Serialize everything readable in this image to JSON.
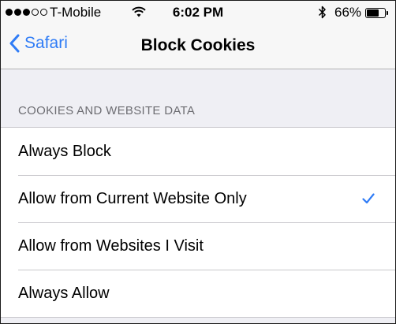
{
  "status_bar": {
    "carrier": "T-Mobile",
    "time": "6:02 PM",
    "battery_percent": "66%",
    "battery_level": 0.66,
    "signal_bars_filled": 3,
    "signal_bars_total": 5,
    "icons": [
      "wifi-icon",
      "bluetooth-icon",
      "battery-icon"
    ]
  },
  "nav": {
    "back_label": "Safari",
    "title": "Block Cookies"
  },
  "section": {
    "header": "COOKIES AND WEBSITE DATA"
  },
  "options": [
    {
      "label": "Always Block",
      "selected": false
    },
    {
      "label": "Allow from Current Website Only",
      "selected": true
    },
    {
      "label": "Allow from Websites I Visit",
      "selected": false
    },
    {
      "label": "Always Allow",
      "selected": false
    }
  ],
  "colors": {
    "accent": "#2f7cf6",
    "background": "#efeff4",
    "cell": "#ffffff",
    "section_text": "#6d6d72"
  }
}
